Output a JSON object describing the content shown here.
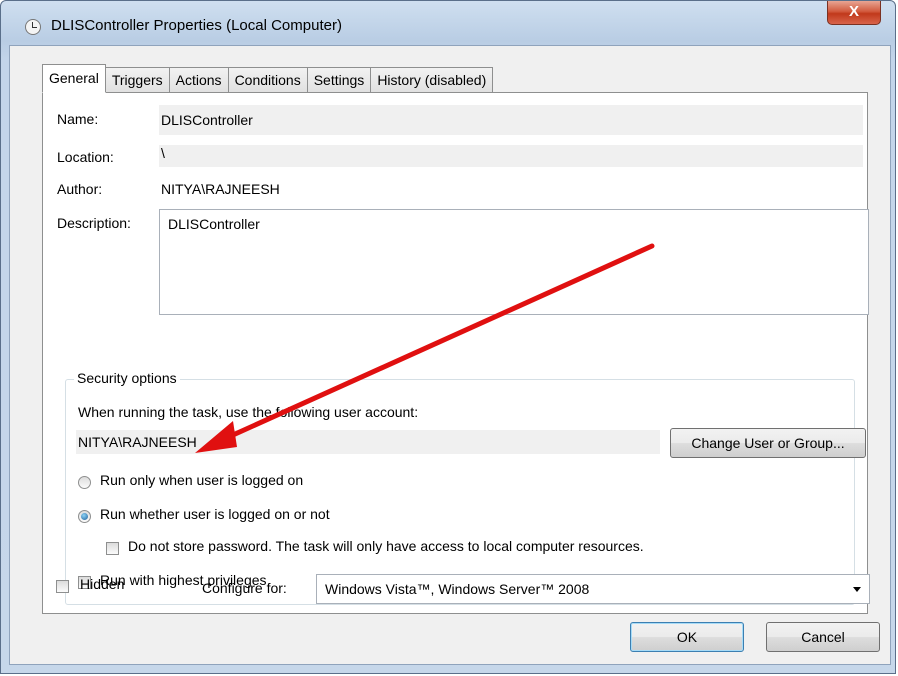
{
  "window": {
    "title": "DLISController Properties (Local Computer)",
    "close_label": "X"
  },
  "tabs": [
    {
      "label": "General",
      "active": true
    },
    {
      "label": "Triggers"
    },
    {
      "label": "Actions"
    },
    {
      "label": "Conditions"
    },
    {
      "label": "Settings"
    },
    {
      "label": "History (disabled)"
    }
  ],
  "general": {
    "name_label": "Name:",
    "name_value": "DLISController",
    "location_label": "Location:",
    "location_value": "\\",
    "author_label": "Author:",
    "author_value": "NITYA\\RAJNEESH",
    "description_label": "Description:",
    "description_value": "DLISController"
  },
  "security": {
    "group_title": "Security options",
    "account_prompt": "When running the task, use the following user account:",
    "account_value": "NITYA\\RAJNEESH",
    "change_button": "Change User or Group...",
    "radio_logged_on": "Run only when user is logged on",
    "radio_whether": "Run whether user is logged on or not",
    "selected_radio": "Run whether user is logged on or not",
    "no_store_password": "Do not store password.  The task will only have access to local computer resources.",
    "highest_privileges": "Run with highest privileges"
  },
  "bottom": {
    "hidden_label": "Hidden",
    "configure_label": "Configure for:",
    "configure_value": "Windows Vista™, Windows Server™ 2008"
  },
  "buttons": {
    "ok": "OK",
    "cancel": "Cancel"
  },
  "annotation": {
    "arrow_color": "#e01010"
  }
}
